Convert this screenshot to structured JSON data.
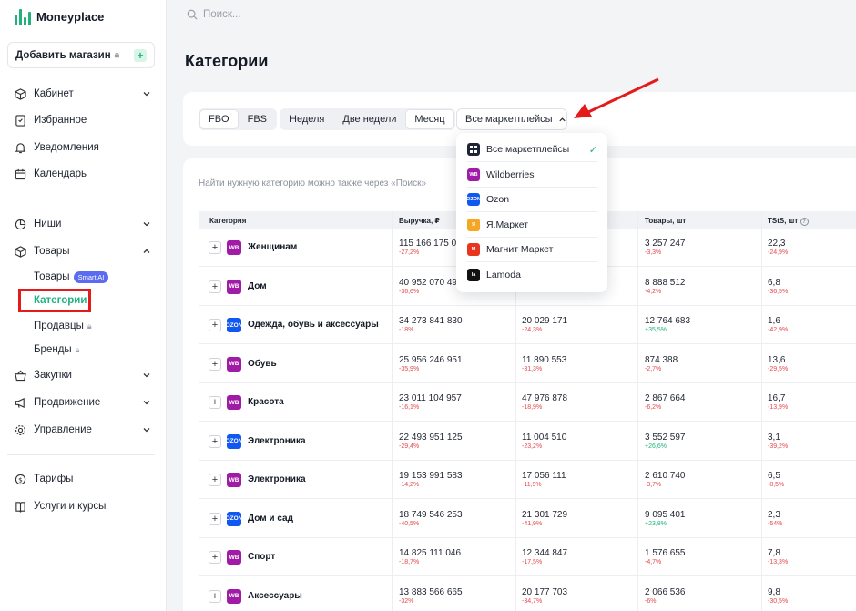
{
  "app": {
    "name": "Moneyplace"
  },
  "sidebar": {
    "add_store": "Добавить магазин",
    "nav_top": [
      {
        "label": "Кабинет",
        "icon": "cube-icon",
        "chevron": "down"
      },
      {
        "label": "Избранное",
        "icon": "bookmark-icon"
      },
      {
        "label": "Уведомления",
        "icon": "bell-icon"
      },
      {
        "label": "Календарь",
        "icon": "calendar-icon"
      }
    ],
    "nav_mid": [
      {
        "label": "Ниши",
        "icon": "pie-chart-icon",
        "chevron": "down"
      },
      {
        "label": "Товары",
        "icon": "cube-icon",
        "chevron": "up"
      }
    ],
    "sub_items": {
      "products": "Товары",
      "products_badge": "Smart AI",
      "categories": "Категории",
      "sellers": "Продавцы",
      "brands": "Бренды"
    },
    "nav_bottom": [
      {
        "label": "Закупки",
        "icon": "basket-icon",
        "chevron": "down"
      },
      {
        "label": "Продвижение",
        "icon": "megaphone-icon",
        "chevron": "down"
      },
      {
        "label": "Управление",
        "icon": "gear-icon",
        "chevron": "down"
      }
    ],
    "nav_footer": [
      {
        "label": "Тарифы",
        "icon": "dollar-icon"
      },
      {
        "label": "Услуги и курсы",
        "icon": "book-icon"
      }
    ]
  },
  "search": {
    "placeholder": "Поиск..."
  },
  "page": {
    "title": "Категории"
  },
  "filters": {
    "fulfillment": [
      "FBO",
      "FBS"
    ],
    "fulfillment_selected": "FBO",
    "period": [
      "Неделя",
      "Две недели",
      "Месяц"
    ],
    "period_selected": "Месяц",
    "marketplace_label": "Все маркетплейсы"
  },
  "dropdown": {
    "items": [
      {
        "label": "Все маркетплейсы",
        "code": "",
        "color": "#1e2433",
        "checked": true
      },
      {
        "label": "Wildberries",
        "code": "WB",
        "color": "#a11ca6",
        "checked": false
      },
      {
        "label": "Ozon",
        "code": "OZON",
        "color": "#1158f0",
        "checked": false
      },
      {
        "label": "Я.Маркет",
        "code": "Я",
        "color": "#f5a623",
        "checked": false
      },
      {
        "label": "Магнит Маркет",
        "code": "M",
        "color": "#e8351f",
        "checked": false
      },
      {
        "label": "Lamoda",
        "code": "la",
        "color": "#111111",
        "checked": false
      }
    ]
  },
  "table": {
    "hint": "Найти нужную категорию можно также через «Поиск»",
    "headers": {
      "category": "Категория",
      "revenue": "Выручка, ₽",
      "products": "Товары, шт",
      "tsts": "TStS, шт"
    },
    "rows": [
      {
        "mp": "WB",
        "name": "Женщинам",
        "revenue": "115 166 175 06",
        "revenue_delta": "-27,2%",
        "c2": "",
        "c2_delta": "",
        "products": "3 257 247",
        "products_delta": "-3,3%",
        "tsts": "22,3",
        "tsts_delta": "-24,9%"
      },
      {
        "mp": "WB",
        "name": "Дом",
        "revenue": "40 952 070 49",
        "revenue_delta": "-36,6%",
        "c2": "",
        "c2_delta": "-36,9%",
        "products": "8 888 512",
        "products_delta": "-4,2%",
        "tsts": "6,8",
        "tsts_delta": "-36,5%"
      },
      {
        "mp": "OZON",
        "name": "Одежда, обувь и аксессуары",
        "revenue": "34 273 841 830",
        "revenue_delta": "-18%",
        "c2": "20 029 171",
        "c2_delta": "-24,3%",
        "products": "12 764 683",
        "products_delta": "+35,5%",
        "tsts": "1,6",
        "tsts_delta": "-42,9%"
      },
      {
        "mp": "WB",
        "name": "Обувь",
        "revenue": "25 956 246 951",
        "revenue_delta": "-35,9%",
        "c2": "11 890 553",
        "c2_delta": "-31,3%",
        "products": "874 388",
        "products_delta": "-2,7%",
        "tsts": "13,6",
        "tsts_delta": "-29,5%"
      },
      {
        "mp": "WB",
        "name": "Красота",
        "revenue": "23 011 104 957",
        "revenue_delta": "-16,1%",
        "c2": "47 976 878",
        "c2_delta": "-18,9%",
        "products": "2 867 664",
        "products_delta": "-6,2%",
        "tsts": "16,7",
        "tsts_delta": "-13,9%"
      },
      {
        "mp": "OZON",
        "name": "Электроника",
        "revenue": "22 493 951 125",
        "revenue_delta": "-29,4%",
        "c2": "11 004 510",
        "c2_delta": "-23,2%",
        "products": "3 552 597",
        "products_delta": "+26,6%",
        "tsts": "3,1",
        "tsts_delta": "-39,2%"
      },
      {
        "mp": "WB",
        "name": "Электроника",
        "revenue": "19 153 991 583",
        "revenue_delta": "-14,2%",
        "c2": "17 056 111",
        "c2_delta": "-11,9%",
        "products": "2 610 740",
        "products_delta": "-3,7%",
        "tsts": "6,5",
        "tsts_delta": "-8,5%"
      },
      {
        "mp": "OZON",
        "name": "Дом и сад",
        "revenue": "18 749 546 253",
        "revenue_delta": "-40,5%",
        "c2": "21 301 729",
        "c2_delta": "-41,9%",
        "products": "9 095 401",
        "products_delta": "+23,8%",
        "tsts": "2,3",
        "tsts_delta": "-54%"
      },
      {
        "mp": "WB",
        "name": "Спорт",
        "revenue": "14 825 111 046",
        "revenue_delta": "-18,7%",
        "c2": "12 344 847",
        "c2_delta": "-17,5%",
        "products": "1 576 655",
        "products_delta": "-4,7%",
        "tsts": "7,8",
        "tsts_delta": "-13,3%"
      },
      {
        "mp": "WB",
        "name": "Аксессуары",
        "revenue": "13 883 566 665",
        "revenue_delta": "-32%",
        "c2": "20 177 703",
        "c2_delta": "-34,7%",
        "products": "2 066 536",
        "products_delta": "-6%",
        "tsts": "9,8",
        "tsts_delta": "-30,5%"
      }
    ]
  }
}
